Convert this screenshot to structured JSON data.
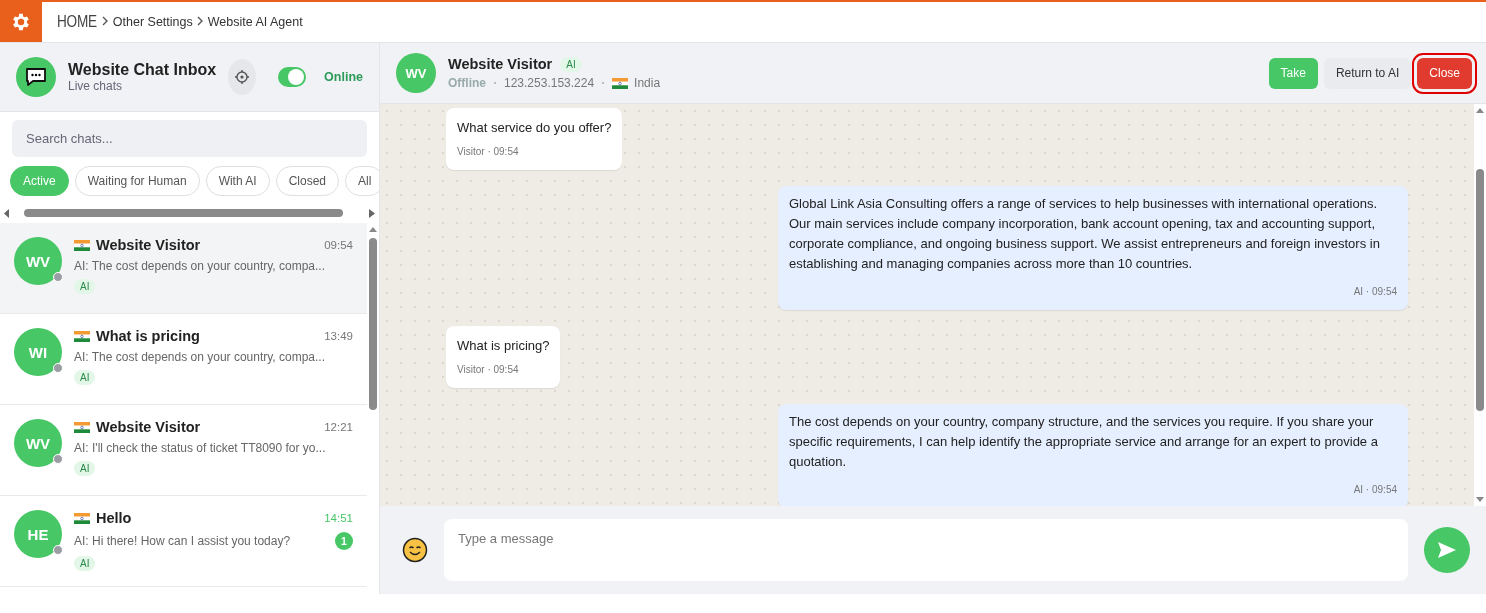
{
  "breadcrumb": {
    "home": "HOME",
    "items": [
      "Other Settings",
      "Website AI Agent"
    ]
  },
  "sidebar": {
    "title": "Website Chat Inbox",
    "subtitle": "Live chats",
    "online": {
      "label": "Online",
      "on": true
    },
    "search": {
      "placeholder": "Search chats..."
    },
    "filters": [
      {
        "label": "Active",
        "selected": true
      },
      {
        "label": "Waiting for Human",
        "selected": false
      },
      {
        "label": "With AI",
        "selected": false
      },
      {
        "label": "Closed",
        "selected": false
      },
      {
        "label": "All",
        "selected": false
      }
    ],
    "chats": [
      {
        "initials": "WV",
        "name": "Website Visitor",
        "time": "09:54",
        "preview": "AI: The cost depends on your country, compa...",
        "tag": "AI",
        "selected": true,
        "online": false
      },
      {
        "initials": "WI",
        "name": "What is pricing",
        "time": "13:49",
        "preview": "AI: The cost depends on your country, compa...",
        "tag": "AI",
        "selected": false,
        "online": false
      },
      {
        "initials": "WV",
        "name": "Website Visitor",
        "time": "12:21",
        "preview": "AI: I'll check the status of ticket TT8090 for yo...",
        "tag": "AI",
        "selected": false,
        "online": false
      },
      {
        "initials": "HE",
        "name": "Hello",
        "time": "14:51",
        "preview": "AI: Hi there! How can I assist you today?",
        "tag": "AI",
        "selected": false,
        "online": false,
        "unread": "1"
      }
    ]
  },
  "conversation": {
    "initials": "WV",
    "name": "Website Visitor",
    "tag": "AI",
    "status": "Offline",
    "ip": "123.253.153.224",
    "country": "India",
    "buttons": [
      {
        "label": "Take",
        "kind": "primary",
        "highlighted": false
      },
      {
        "label": "Return to AI",
        "kind": "secondary",
        "highlighted": false
      },
      {
        "label": "Close",
        "kind": "danger",
        "highlighted": true
      }
    ],
    "messages": [
      {
        "kind": "visitor",
        "text": "What service do you offer?",
        "meta": "Visitor · 09:54"
      },
      {
        "kind": "ai",
        "text": "Global Link Asia Consulting offers a range of services to help businesses with international operations. Our main services include company incorporation, bank account opening, tax and accounting support, corporate compliance, and ongoing business support. We assist entrepreneurs and foreign investors in establishing and managing companies across more than 10 countries.",
        "meta": "AI · 09:54"
      },
      {
        "kind": "visitor",
        "text": "What is pricing?",
        "meta": "Visitor · 09:54"
      },
      {
        "kind": "ai",
        "text": "The cost depends on your country, company structure, and the services you require. If you share your specific requirements, I can help identify the appropriate service and arrange for an expert to provide a quotation.",
        "meta": "AI · 09:54"
      }
    ],
    "composer": {
      "placeholder": "Type a message"
    }
  }
}
